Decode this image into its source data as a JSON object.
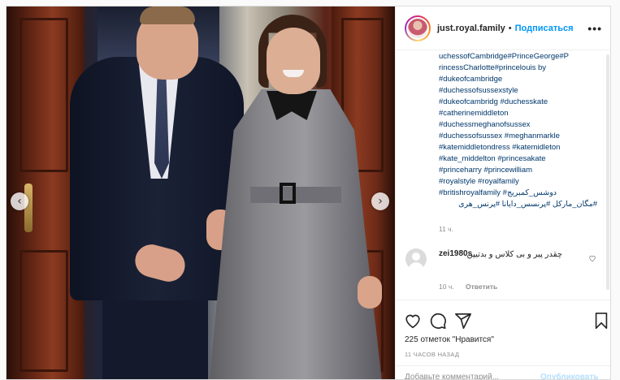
{
  "post": {
    "username": "just.royal.family",
    "separator": "•",
    "follow_label": "Подписаться",
    "more_label": "•••"
  },
  "caption": {
    "lines": [
      "uchessofCambridge#PrinceGeorge#P",
      "rincessCharlotte#princelouis by",
      "#dukeofcambridge",
      "#duchessofsussexstyle",
      "#dukeofcambridg #duchesskate",
      "#catherinemiddleton",
      "#duchessmeghanofsussex",
      "#duchessofsussex #meghanmarkle",
      "#katemiddletondress #katemidleton",
      "#kate_middelton #princesakate",
      "#princeharry #princewilliam",
      "#royalstyle #royalfamily",
      "#britishroyalfamily #دوشس_کمبریج",
      "#مگان_مارکل #پرنسس_دایانا #پرنس_هری"
    ],
    "time": "11 ч."
  },
  "comment": {
    "username": "zei1980s",
    "text": "چقدر پیر و بی کلاس و بدتیپن",
    "time": "10 ч.",
    "reply_label": "Ответить",
    "heart_icon": "heart-outline-icon"
  },
  "actions": {
    "icons": [
      "heart-icon",
      "comment-icon",
      "share-icon",
      "bookmark-icon"
    ],
    "likes": "225 отметок \"Нравится\"",
    "posted": "11 ЧАСОВ НАЗАД"
  },
  "add_comment": {
    "placeholder": "Добавьте комментарий...",
    "publish_label": "Опубликовать"
  },
  "carousel": {
    "prev": "‹",
    "next": "›"
  },
  "colors": {
    "accent": "#0095f6",
    "hashtag": "#00376b",
    "muted": "#8e8e8e"
  }
}
